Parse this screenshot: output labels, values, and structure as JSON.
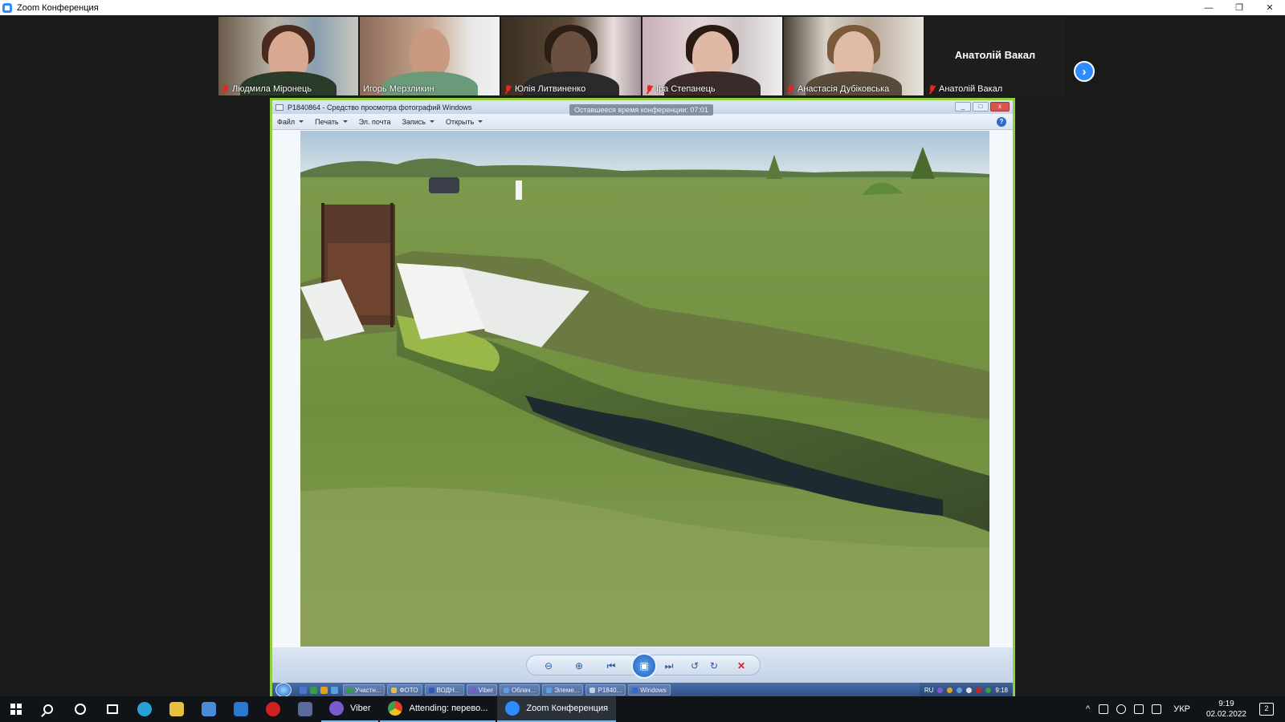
{
  "zoom": {
    "title": "Zoom Конференция",
    "minimize": "—",
    "restore": "❐",
    "close": "✕"
  },
  "participants": [
    {
      "name": "Людмила Міронець",
      "active": false,
      "muted": true
    },
    {
      "name": "Игорь Мерзликин",
      "active": true,
      "muted": false
    },
    {
      "name": "Юлія Литвиненко",
      "active": false,
      "muted": true
    },
    {
      "name": "Іра Степанець",
      "active": false,
      "muted": true
    },
    {
      "name": "Анастасія Дубіковська",
      "active": false,
      "muted": true
    },
    {
      "name": "Анатолій Вакал",
      "active": false,
      "muted": true
    }
  ],
  "gallery_next": "›",
  "photo_viewer": {
    "title": "P1840864 - Средство просмотра фотографий Windows",
    "time_left": "Оставшееся время конференции: 07:01",
    "menu": [
      "Файл",
      "Печать",
      "Эл. почта",
      "Запись",
      "Открыть"
    ],
    "help": "?"
  },
  "xp_taskbar": {
    "tasks": [
      "Участн...",
      "ФОТО",
      "ВОДН...",
      "Viber",
      "Облач...",
      "Элеме...",
      "P1840...",
      "Windows"
    ],
    "lang": "RU",
    "time": "9:18"
  },
  "win10_taskbar": {
    "apps": [
      {
        "label": "Viber",
        "active": false
      },
      {
        "label": "Attending: перево...",
        "active": false
      },
      {
        "label": "Zoom Конференция",
        "active": true
      }
    ],
    "lang": "УКР",
    "time": "9:19",
    "date": "02.02.2022",
    "notifications": "2"
  },
  "colors": {
    "zoom_blue": "#2d8cff",
    "active_speaker": "#b7e34b",
    "share_border": "#8fcf3c"
  }
}
